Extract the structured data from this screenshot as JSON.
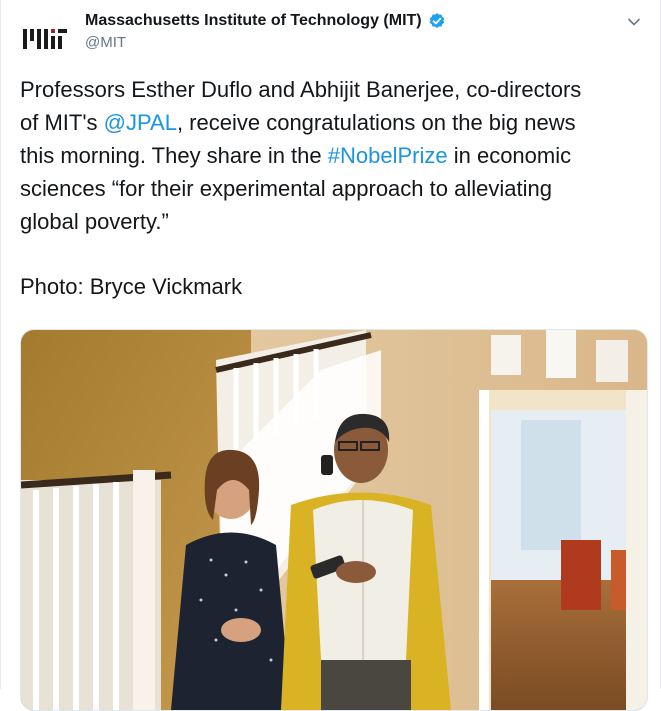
{
  "account": {
    "display_name": "Massachusetts Institute of Technology (MIT)",
    "handle": "@MIT",
    "verified": true,
    "avatar_icon": "mit-logo-icon",
    "logo_text": "MIT"
  },
  "tweet": {
    "lines": [
      [
        {
          "text": "Professors Esther Duflo and Abhijit Banerjee, co-directors",
          "link": false
        }
      ],
      [
        {
          "text": "of MIT's ",
          "link": false
        },
        {
          "text": "@JPAL",
          "link": true
        },
        {
          "text": ", receive congratulations on the big news",
          "link": false
        }
      ],
      [
        {
          "text": "this morning. They share in the ",
          "link": false
        },
        {
          "text": "#NobelPrize",
          "link": true
        },
        {
          "text": " in economic",
          "link": false
        }
      ],
      [
        {
          "text": "sciences “for their experimental approach to alleviating",
          "link": false
        }
      ],
      [
        {
          "text": "global poverty.”",
          "link": false
        }
      ]
    ],
    "credit": "Photo: Bryce Vickmark"
  },
  "menu": {
    "icon": "chevron-down-icon"
  },
  "media": {
    "type": "photo"
  },
  "colors": {
    "link": "#1b95e0",
    "verified": "#1da1f2",
    "text": "#14171a",
    "secondary": "#657786"
  }
}
